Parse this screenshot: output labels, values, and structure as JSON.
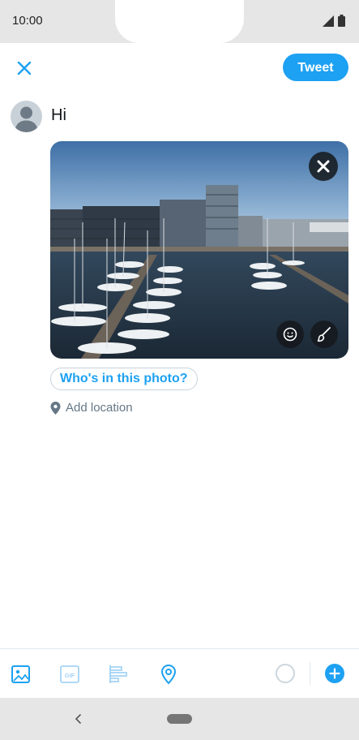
{
  "status_bar": {
    "time": "10:00"
  },
  "header": {
    "tweet_label": "Tweet"
  },
  "compose": {
    "text": "Hi"
  },
  "media": {
    "tag_people_label": "Who's in this photo?",
    "add_location_label": "Add location"
  },
  "toolbar": {
    "icons": [
      "image-icon",
      "gif-icon",
      "poll-icon",
      "location-icon"
    ]
  },
  "colors": {
    "accent": "#1da1f2",
    "muted": "#657786"
  }
}
